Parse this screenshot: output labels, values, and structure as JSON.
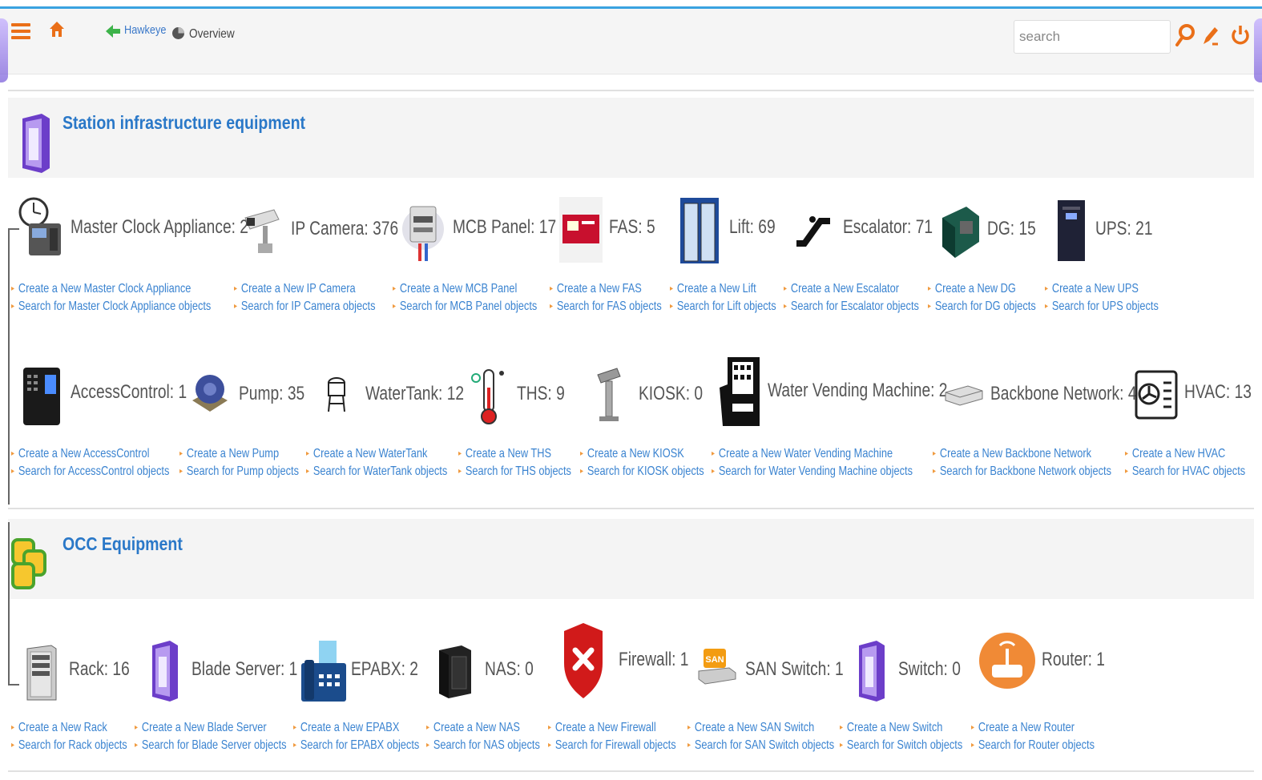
{
  "toolbar": {
    "crumb_link": "Hawkeye",
    "crumb_current": "Overview",
    "search_placeholder": "search"
  },
  "sections": [
    {
      "title": "Station infrastructure equipment",
      "rows": [
        [
          {
            "label": "Master Clock Appliance: 2",
            "create": "Create a New Master Clock Appliance",
            "search": "Search for Master Clock Appliance objects",
            "icon": "clock-appliance-icon"
          },
          {
            "label": "IP Camera: 376",
            "create": "Create a New IP Camera",
            "search": "Search for IP Camera objects",
            "icon": "ip-camera-icon"
          },
          {
            "label": "MCB Panel: 17",
            "create": "Create a New MCB Panel",
            "search": "Search for MCB Panel objects",
            "icon": "mcb-panel-icon"
          },
          {
            "label": "FAS: 5",
            "create": "Create a New FAS",
            "search": "Search for FAS objects",
            "icon": "fire-alarm-icon"
          },
          {
            "label": "Lift: 69",
            "create": "Create a New Lift",
            "search": "Search for Lift objects",
            "icon": "lift-icon"
          },
          {
            "label": "Escalator: 71",
            "create": "Create a New Escalator",
            "search": "Search for Escalator objects",
            "icon": "escalator-icon"
          },
          {
            "label": "DG: 15",
            "create": "Create a New DG",
            "search": "Search for DG objects",
            "icon": "generator-icon"
          },
          {
            "label": "UPS: 21",
            "create": "Create a New UPS",
            "search": "Search for UPS objects",
            "icon": "ups-icon"
          }
        ],
        [
          {
            "label": "AccessControl: 1",
            "create": "Create a New AccessControl",
            "search": "Search for AccessControl objects",
            "icon": "access-control-icon"
          },
          {
            "label": "Pump: 35",
            "create": "Create a New Pump",
            "search": "Search for Pump objects",
            "icon": "pump-icon"
          },
          {
            "label": "WaterTank: 12",
            "create": "Create a New WaterTank",
            "search": "Search for WaterTank objects",
            "icon": "water-tank-icon"
          },
          {
            "label": "THS: 9",
            "create": "Create a New THS",
            "search": "Search for THS objects",
            "icon": "thermometer-icon"
          },
          {
            "label": "KIOSK: 0",
            "create": "Create a New KIOSK",
            "search": "Search for KIOSK objects",
            "icon": "kiosk-icon"
          },
          {
            "label": "Water Vending Machine: 2",
            "create": "Create a New Water Vending Machine",
            "search": "Search for Water Vending Machine objects",
            "icon": "vending-machine-icon"
          },
          {
            "label": "Backbone Network: 4",
            "create": "Create a New Backbone Network",
            "search": "Search for Backbone Network objects",
            "icon": "network-device-icon"
          },
          {
            "label": "HVAC: 13",
            "create": "Create a New HVAC",
            "search": "Search for HVAC objects",
            "icon": "hvac-icon"
          }
        ]
      ]
    },
    {
      "title": "OCC Equipment",
      "rows": [
        [
          {
            "label": "Rack: 16",
            "create": "Create a New Rack",
            "search": "Search for Rack objects",
            "icon": "rack-icon"
          },
          {
            "label": "Blade Server: 1",
            "create": "Create a New Blade Server",
            "search": "Search for Blade Server objects",
            "icon": "blade-server-icon"
          },
          {
            "label": "EPABX: 2",
            "create": "Create a New EPABX",
            "search": "Search for EPABX objects",
            "icon": "epabx-icon"
          },
          {
            "label": "NAS: 0",
            "create": "Create a New NAS",
            "search": "Search for NAS objects",
            "icon": "nas-icon"
          },
          {
            "label": "Firewall: 1",
            "create": "Create a New Firewall",
            "search": "Search for Firewall objects",
            "icon": "firewall-icon"
          },
          {
            "label": "SAN Switch: 1",
            "create": "Create a New SAN Switch",
            "search": "Search for SAN Switch objects",
            "icon": "san-switch-icon"
          },
          {
            "label": "Switch: 0",
            "create": "Create a New Switch",
            "search": "Search for Switch objects",
            "icon": "switch-icon"
          },
          {
            "label": "Router: 1",
            "create": "Create a New Router",
            "search": "Search for Router objects",
            "icon": "router-icon"
          }
        ]
      ]
    }
  ],
  "icon_text": {
    "san_badge": "SAN"
  },
  "colors": {
    "accent_blue": "#3a83d0",
    "title_blue": "#2a78c8",
    "orange": "#ea6f18",
    "bullet_orange": "#f09a3e"
  }
}
